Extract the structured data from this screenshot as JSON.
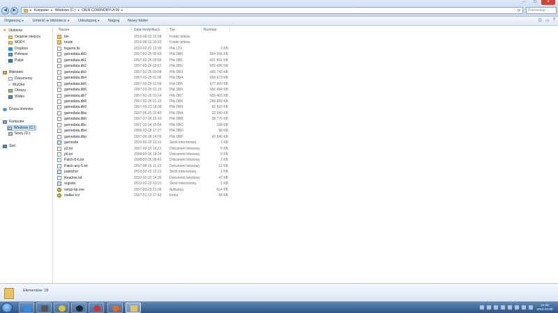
{
  "address": {
    "crumbs": [
      "Komputer",
      "Windows (C:)",
      "CIEŃ CZARNOBYLA 06"
    ],
    "search_placeholder": "Przeszukaj: ..."
  },
  "toolbar": {
    "organize": "Organizuj",
    "include_library": "Umieść w bibliotece",
    "share": "Udostępnij",
    "burn": "Nagraj",
    "new_folder": "Nowy folder"
  },
  "nav": {
    "favorites": "Ulubione",
    "recent": "Ostatnie miejsca",
    "mody": "MODY",
    "dropbox": "Dropbox",
    "downloads": "Pobrane",
    "desktop": "Pulpit",
    "libraries": "Biblioteki",
    "documents": "Dokumenty",
    "music": "Muzyka",
    "pictures": "Obrazy",
    "videos": "Wideo",
    "homegroup": "Grupa domowa",
    "computer": "Komputer",
    "drive_c": "Windows (C:)",
    "drive_d": "Nowy (D:)",
    "network": "Sieć"
  },
  "columns": {
    "name": "Nazwa",
    "date": "Data modyfikacji",
    "type": "Typ",
    "size": "Rozmiar"
  },
  "files": [
    {
      "name": "bin",
      "date": "2016-08-03 12:58",
      "type": "Folder plików",
      "size": "",
      "icon": "folder"
    },
    {
      "name": "mods",
      "date": "2016-08-12 20:20",
      "type": "Folder plików",
      "size": "",
      "icon": "folder"
    },
    {
      "name": "fsgame.ltx",
      "date": "2010-02-22 13:39",
      "type": "Plik LTX",
      "size": "2 KB",
      "icon": "file"
    },
    {
      "name": "gamedata.db0",
      "date": "2007-02-25 00:55",
      "type": "Plik DB0",
      "size": "664 206 KB",
      "icon": "file"
    },
    {
      "name": "gamedata.db1",
      "date": "2007-02-25 00:56",
      "type": "Plik DB1",
      "size": "601 831 KB",
      "icon": "file"
    },
    {
      "name": "gamedata.db2",
      "date": "2007-02-25 00:57",
      "type": "Plik DB2",
      "size": "655 436 KB",
      "icon": "file"
    },
    {
      "name": "gamedata.db3",
      "date": "2007-02-25 00:58",
      "type": "Plik DB3",
      "size": "666 743 KB",
      "icon": "file"
    },
    {
      "name": "gamedata.db4",
      "date": "2007-02-25 01:06",
      "type": "Plik DB4",
      "size": "659 673 KB",
      "icon": "file"
    },
    {
      "name": "gamedata.db5",
      "date": "2007-02-25 01:09",
      "type": "Plik DB5",
      "size": "677 300 KB",
      "icon": "file"
    },
    {
      "name": "gamedata.db6",
      "date": "2007-02-25 01:10",
      "type": "Plik DB6",
      "size": "656 494 KB",
      "icon": "file"
    },
    {
      "name": "gamedata.db7",
      "date": "2007-02-25 01:14",
      "type": "Plik DB7",
      "size": "655 403 KB",
      "icon": "file"
    },
    {
      "name": "gamedata.db8",
      "date": "2007-02-25 01:15",
      "type": "Plik DB8",
      "size": "289 059 KB",
      "icon": "file"
    },
    {
      "name": "gamedata.db9",
      "date": "2007-03-23 18:38",
      "type": "Plik DB9",
      "size": "82 693 KB",
      "icon": "file"
    },
    {
      "name": "gamedata.dba",
      "date": "2007-05-25 23:40",
      "type": "Plik DBA",
      "size": "22 349 KB",
      "icon": "file"
    },
    {
      "name": "gamedata.dbb",
      "date": "2007-07-26 15:10",
      "type": "Plik DBB",
      "size": "38 775 KB",
      "icon": "file"
    },
    {
      "name": "gamedata.dbc",
      "date": "2007-10-24 16:54",
      "type": "Plik DBC",
      "size": "158 KB",
      "icon": "file"
    },
    {
      "name": "gamedata.dbd",
      "date": "2008-03-18 17:27",
      "type": "Plik DBD",
      "size": "99 KB",
      "icon": "file"
    },
    {
      "name": "gamedata.dbp",
      "date": "2007-06-28 14:26",
      "type": "Plik DBP",
      "size": "42 940 KB",
      "icon": "file"
    },
    {
      "name": "gamesite",
      "date": "2010-02-22 13:31",
      "type": "Skrót internetowy",
      "size": "1 KB",
      "icon": "shortcut"
    },
    {
      "name": "p3.txt",
      "date": "2007-03-10 14:21",
      "type": "Dokument tekstowy",
      "size": "0 KB",
      "icon": "text"
    },
    {
      "name": "p6.txt",
      "date": "2008-03-06 18:24",
      "type": "Dokument tekstowy",
      "size": "0 KB",
      "icon": "text"
    },
    {
      "name": "Patch-5-6.txt",
      "date": "2008-03-06 09:42",
      "type": "Dokument tekstowy",
      "size": "2 KB",
      "icon": "text"
    },
    {
      "name": "Patch-any-5.txt",
      "date": "2007-08-15 11:23",
      "type": "Dokument tekstowy",
      "size": "12 KB",
      "icon": "text"
    },
    {
      "name": "publisher",
      "date": "2010-02-22 13:31",
      "type": "Skrót internetowy",
      "size": "1 KB",
      "icon": "shortcut"
    },
    {
      "name": "Readme.txt",
      "date": "2010-02-22 14:39",
      "type": "Dokument tekstowy",
      "size": "47 KB",
      "icon": "text"
    },
    {
      "name": "register",
      "date": "2010-02-22 13:31",
      "type": "Skrót internetowy",
      "size": "1 KB",
      "icon": "shortcut"
    },
    {
      "name": "setup-bp.exe",
      "date": "2007-03-23 21:06",
      "type": "Aplikacja",
      "size": "514 KB",
      "icon": "rad"
    },
    {
      "name": "stalker.ico",
      "date": "2007-01-13 17:42",
      "type": "Ikona",
      "size": "68 KB",
      "icon": "rad"
    }
  ],
  "details": {
    "item_count": "Elementów: 28"
  },
  "taskbar": {
    "time": "11:20",
    "date": "2016-03-09"
  }
}
